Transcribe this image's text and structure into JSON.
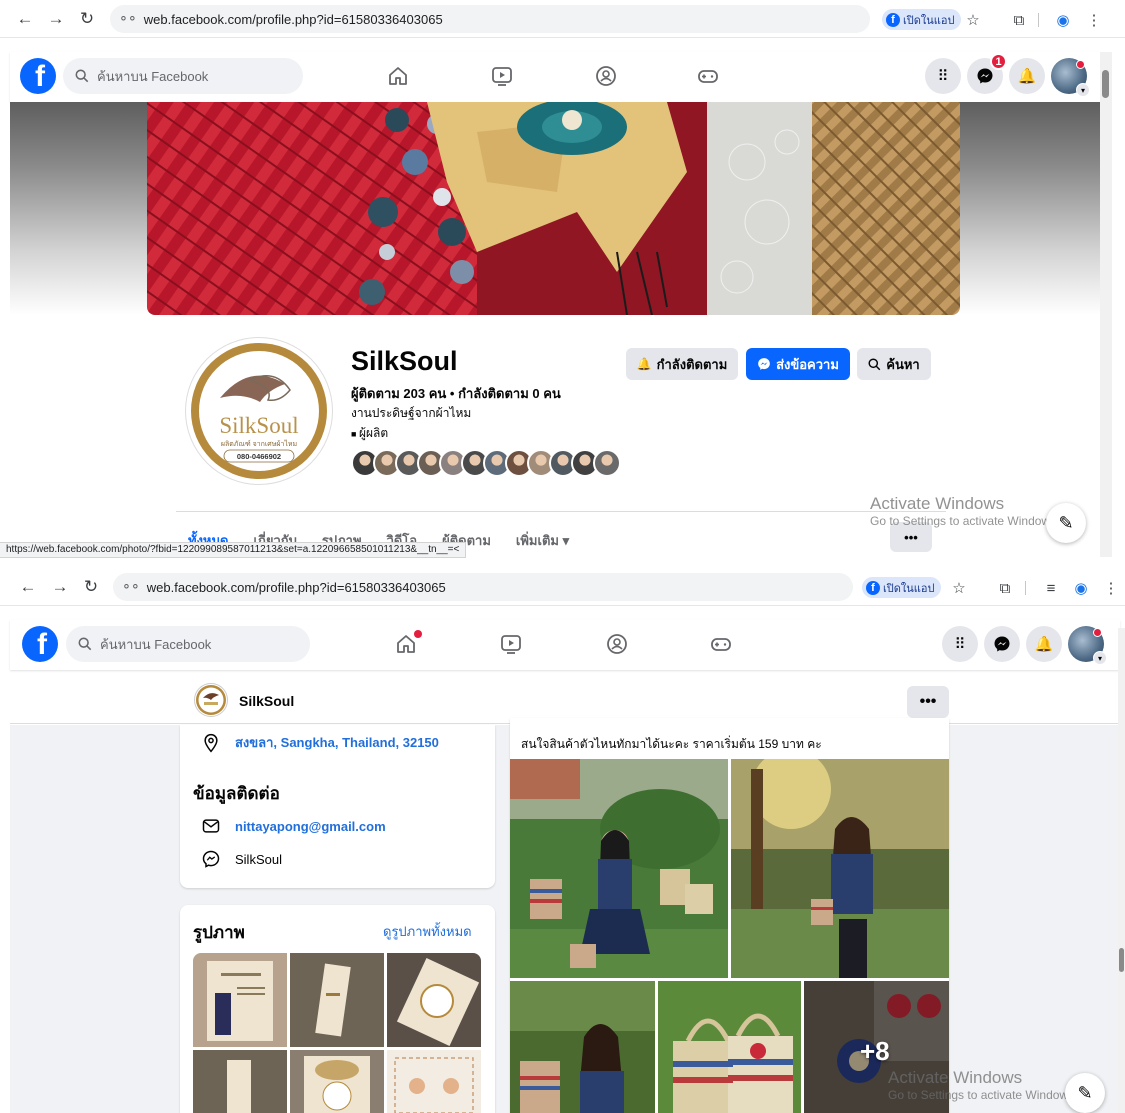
{
  "browser1": {
    "url": "web.facebook.com/profile.php?id=61580336403065",
    "open_app_label": "เปิดในแอป",
    "status_url": "https://web.facebook.com/photo/?fbid=122099089587011213&set=a.122096658501011213&__tn__=<"
  },
  "browser2": {
    "url": "web.facebook.com/profile.php?id=61580336403065",
    "open_app_label": "เปิดในแอป"
  },
  "fb": {
    "search_placeholder": "ค้นหาบน Facebook",
    "messenger_badge": "1"
  },
  "profile": {
    "name": "SilkSoul",
    "stats": "ผู้ติดตาม 203 คน • กำลังติดตาม 0 คน",
    "description": "งานประดิษฐ์จากผ้าไหม",
    "category": "ผู้ผลิต",
    "logo_text": "SilkSoul",
    "logo_subtext": "ผลิตภัณฑ์ จากเศษผ้าไหม",
    "logo_phone": "080-0466902",
    "buttons": {
      "following": "กำลังติดตาม",
      "message": "ส่งข้อความ",
      "search": "ค้นหา"
    },
    "tabs": [
      "ทั้งหมด",
      "เกี่ยวกับ",
      "รูปภาพ",
      "วิดีโอ",
      "ผู้ติดตาม",
      "เพิ่มเติม ▾"
    ],
    "more_button": "•••",
    "follower_face_colors": [
      "#3a3a3a",
      "#7a6a5a",
      "#5a5a5a",
      "#6b5f55",
      "#8a8080",
      "#4a4a4a",
      "#5d6b7a",
      "#6e5040",
      "#a08c78",
      "#505a60",
      "#404040",
      "#6a6a6a"
    ]
  },
  "header2": {
    "name": "SilkSoul",
    "more_button": "•••"
  },
  "about": {
    "location": "สงขลา, Sangkha, Thailand, 32150",
    "contact_title": "ข้อมูลติดต่อ",
    "email": "nittayapong@gmail.com",
    "messenger": "SilkSoul"
  },
  "photos": {
    "title": "รูปภาพ",
    "see_all": "ดูรูปภาพทั้งหมด"
  },
  "post": {
    "text": "สนใจสินค้าตัวไหนทักมาได้นะคะ ราคาเริ่มต้น 159 บาท คะ",
    "more_count": "+8"
  },
  "watermark": {
    "line1": "Activate Windows",
    "line2": "Go to Settings to activate Windows."
  },
  "colors": {
    "fb_blue": "#0866ff",
    "link_blue": "#216fdb",
    "badge_red": "#e41e3f",
    "page_bg": "#f0f2f5"
  }
}
